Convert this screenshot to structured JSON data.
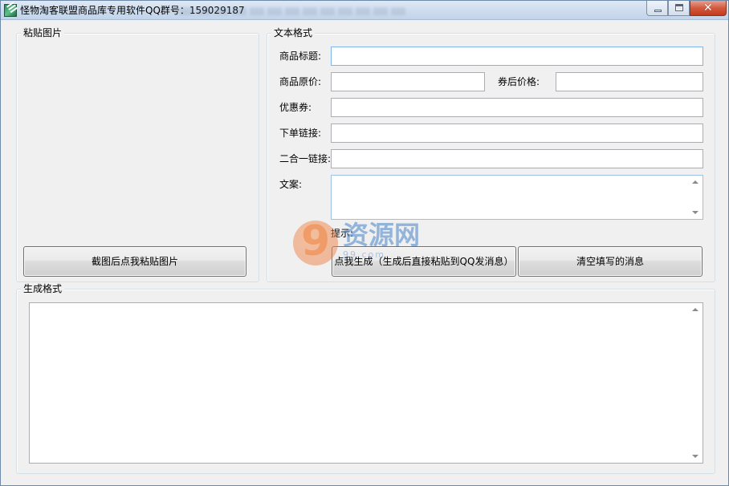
{
  "window": {
    "title": "怪物淘客联盟商品库专用软件QQ群号：159029187",
    "minimize_label": "",
    "maximize_label": "",
    "close_label": "✕"
  },
  "paste_group": {
    "label": "粘贴图片",
    "paste_button": "截图后点我粘贴图片"
  },
  "text_group": {
    "label": "文本格式",
    "fields": {
      "product_title": {
        "label": "商品标题:",
        "value": ""
      },
      "original_price": {
        "label": "商品原价:",
        "value": ""
      },
      "coupon_price": {
        "label": "券后价格:",
        "value": ""
      },
      "coupon": {
        "label": "优惠券:",
        "value": ""
      },
      "order_link": {
        "label": "下单链接:",
        "value": ""
      },
      "combined_link": {
        "label": "二合一链接:",
        "value": ""
      },
      "copy_text": {
        "label": "文案:",
        "value": ""
      }
    },
    "hint_label": "提示:",
    "generate_button": "点我生成（生成后直接粘贴到QQ发消息）",
    "clear_button": "清空填写的消息"
  },
  "output_group": {
    "label": "生成格式",
    "value": ""
  },
  "watermark": {
    "number": "9",
    "text": "资源网",
    "subtext": "99.com"
  }
}
